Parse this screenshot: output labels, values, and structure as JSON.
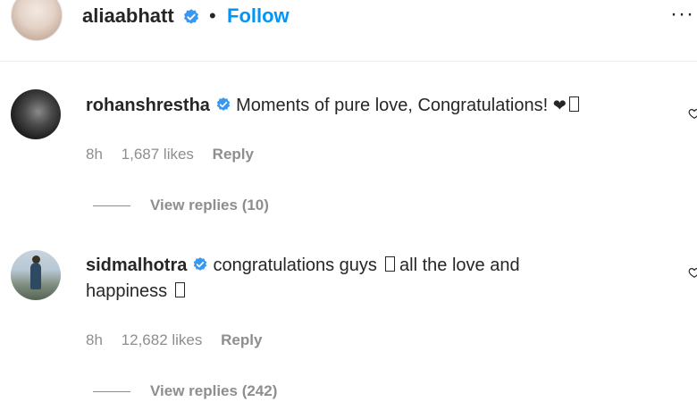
{
  "header": {
    "username": "aliaabhatt",
    "separator": "•",
    "follow_label": "Follow",
    "more_label": "···"
  },
  "comments": [
    {
      "username": "rohanshrestha",
      "text": "Moments of pure love, Congratulations! ",
      "trailing_glyphs": "❤",
      "time": "8h",
      "likes": "1,687 likes",
      "reply_label": "Reply",
      "view_replies": "View replies (10)"
    },
    {
      "username": "sidmalhotra",
      "text_line1": "congratulations guys ",
      "text_line1b": " all the love and",
      "text_line2": "happiness ",
      "time": "8h",
      "likes": "12,682 likes",
      "reply_label": "Reply",
      "view_replies": "View replies (242)"
    }
  ],
  "colors": {
    "link_blue": "#0095f6",
    "verified_blue": "#3897f0",
    "meta_gray": "#8e8e8e",
    "text": "#262626"
  },
  "icons": {
    "verified": "verified-badge-icon",
    "heart": "heart-outline-icon",
    "more": "more-options-icon"
  }
}
